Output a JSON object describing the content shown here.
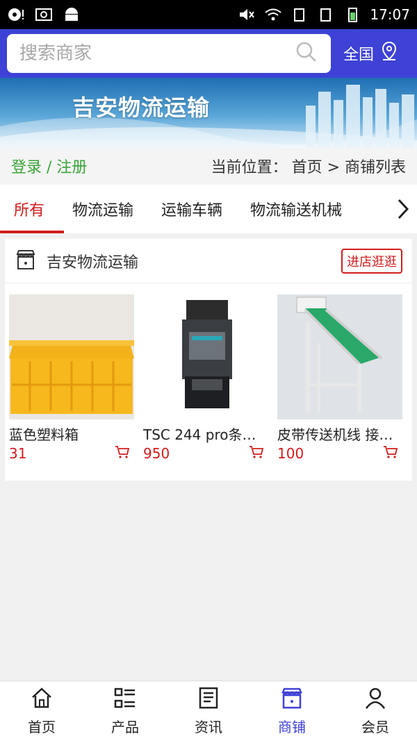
{
  "status_bar": {
    "time": "17:07"
  },
  "header": {
    "search_placeholder": "搜索商家",
    "region_label": "全国"
  },
  "banner": {
    "title": "吉安物流运输"
  },
  "breadcrumb": {
    "login_label": "登录 / 注册",
    "location_prefix": "当前位置：",
    "path": "首页 > 商铺列表"
  },
  "tabs": [
    {
      "label": "所有",
      "active": true
    },
    {
      "label": "物流运输"
    },
    {
      "label": "运输车辆"
    },
    {
      "label": "物流输送机械"
    }
  ],
  "shop": {
    "name": "吉安物流运输",
    "enter_label": "进店逛逛",
    "products": [
      {
        "name": "蓝色塑料箱",
        "price": "31"
      },
      {
        "name": "TSC 244 pro条…",
        "price": "950"
      },
      {
        "name": "皮带传送机线 接…",
        "price": "100"
      }
    ]
  },
  "bottom_nav": [
    {
      "label": "首页",
      "icon": "home-icon"
    },
    {
      "label": "产品",
      "icon": "list-icon"
    },
    {
      "label": "资讯",
      "icon": "news-icon"
    },
    {
      "label": "商铺",
      "icon": "store-icon",
      "active": true
    },
    {
      "label": "会员",
      "icon": "user-icon"
    }
  ],
  "colors": {
    "primary": "#3e42d6",
    "accent_red": "#d21c1c",
    "login_green": "#3aa53a"
  }
}
